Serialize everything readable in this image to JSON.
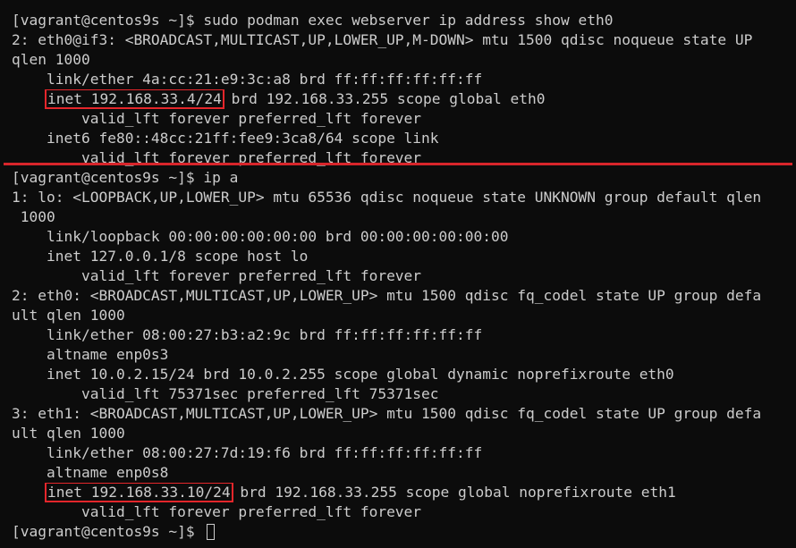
{
  "terminal": {
    "lines": [
      "[vagrant@centos9s ~]$ sudo podman exec webserver ip address show eth0",
      "2: eth0@if3: <BROADCAST,MULTICAST,UP,LOWER_UP,M-DOWN> mtu 1500 qdisc noqueue state UP",
      "qlen 1000",
      "    link/ether 4a:cc:21:e9:3c:a8 brd ff:ff:ff:ff:ff:ff",
      "",
      "        valid_lft forever preferred_lft forever",
      "    inet6 fe80::48cc:21ff:fee9:3ca8/64 scope link",
      "        valid_lft forever preferred_lft forever",
      "[vagrant@centos9s ~]$ ip a",
      "1: lo: <LOOPBACK,UP,LOWER_UP> mtu 65536 qdisc noqueue state UNKNOWN group default qlen",
      " 1000",
      "    link/loopback 00:00:00:00:00:00 brd 00:00:00:00:00:00",
      "    inet 127.0.0.1/8 scope host lo",
      "        valid_lft forever preferred_lft forever",
      "2: eth0: <BROADCAST,MULTICAST,UP,LOWER_UP> mtu 1500 qdisc fq_codel state UP group defa",
      "ult qlen 1000",
      "    link/ether 08:00:27:b3:a2:9c brd ff:ff:ff:ff:ff:ff",
      "    altname enp0s3",
      "    inet 10.0.2.15/24 brd 10.0.2.255 scope global dynamic noprefixroute eth0",
      "        valid_lft 75371sec preferred_lft 75371sec",
      "3: eth1: <BROADCAST,MULTICAST,UP,LOWER_UP> mtu 1500 qdisc fq_codel state UP group defa",
      "ult qlen 1000",
      "    link/ether 08:00:27:7d:19:f6 brd ff:ff:ff:ff:ff:ff",
      "    altname enp0s8",
      "",
      "        valid_lft forever preferred_lft forever",
      "[vagrant@centos9s ~]$ "
    ],
    "highlight_1": {
      "prefix": "    ",
      "boxed": "inet 192.168.33.4/24",
      "rest": " brd 192.168.33.255 scope global eth0"
    },
    "highlight_2": {
      "prefix": "    ",
      "boxed": "inet 192.168.33.10/24",
      "rest": " brd 192.168.33.255 scope global noprefixroute eth1"
    },
    "colors": {
      "background": "#0c0c0c",
      "text": "#cccccc",
      "highlight_box": "#e5262b",
      "divider": "#d8252b"
    }
  }
}
